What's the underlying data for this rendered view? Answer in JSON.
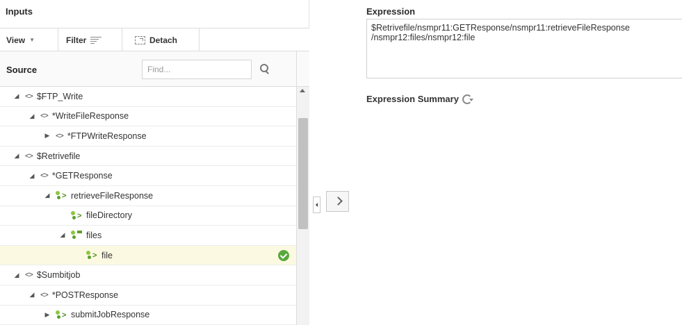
{
  "inputs_panel": {
    "title": "Inputs",
    "toolbar": {
      "view_label": "View",
      "filter_label": "Filter",
      "detach_label": "Detach"
    },
    "source_label": "Source",
    "find": {
      "placeholder": "Find...",
      "value": ""
    }
  },
  "tree": [
    {
      "label": "$FTP_Write",
      "depth": 0,
      "toggle": "expanded",
      "icon": "diamond-icon"
    },
    {
      "label": "*WriteFileResponse",
      "depth": 1,
      "toggle": "expanded",
      "icon": "diamond-icon"
    },
    {
      "label": "*FTPWriteResponse",
      "depth": 2,
      "toggle": "collapsed",
      "icon": "diamond-icon"
    },
    {
      "label": "$Retrivefile",
      "depth": 0,
      "toggle": "expanded",
      "icon": "diamond-icon"
    },
    {
      "label": "*GETResponse",
      "depth": 1,
      "toggle": "expanded",
      "icon": "diamond-icon"
    },
    {
      "label": "retrieveFileResponse",
      "depth": 2,
      "toggle": "expanded",
      "icon": "element-icon"
    },
    {
      "label": "fileDirectory",
      "depth": 3,
      "toggle": "none",
      "icon": "element-icon"
    },
    {
      "label": "files",
      "depth": 3,
      "toggle": "expanded",
      "icon": "element-list-icon"
    },
    {
      "label": "file",
      "depth": 4,
      "toggle": "none",
      "icon": "element-icon",
      "selected": true
    },
    {
      "label": "$Sumbitjob",
      "depth": 0,
      "toggle": "expanded",
      "icon": "diamond-icon"
    },
    {
      "label": "*POSTResponse",
      "depth": 1,
      "toggle": "expanded",
      "icon": "diamond-icon"
    },
    {
      "label": "submitJobResponse",
      "depth": 2,
      "toggle": "collapsed",
      "icon": "element-icon"
    }
  ],
  "expression": {
    "title": "Expression",
    "value": "$Retrivefile/nsmpr11:GETResponse/nsmpr11:retrieveFileResponse\n/nsmpr12:files/nsmpr12:file"
  },
  "summary": {
    "title": "Expression Summary"
  }
}
